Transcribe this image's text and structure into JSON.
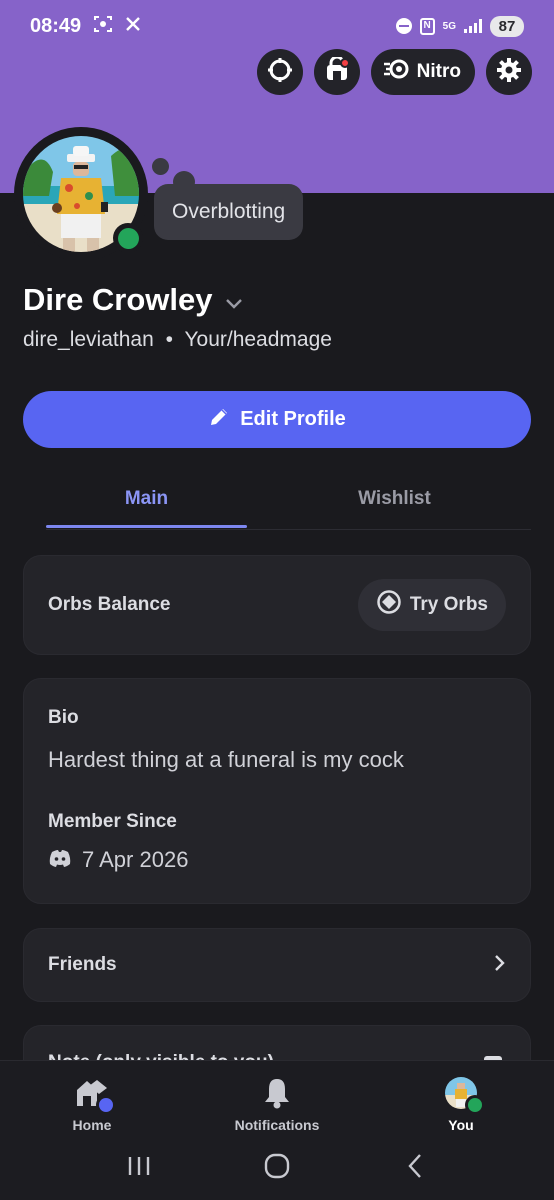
{
  "status_bar": {
    "time": "08:49",
    "network": "5G",
    "battery": "87",
    "icons": [
      "screenshot-icon",
      "x-icon",
      "dnd-icon",
      "nfc-icon",
      "signal-icon",
      "battery-icon"
    ]
  },
  "colors": {
    "banner": "#8663c9",
    "background": "#1a1a1e",
    "accent": "#5865f2",
    "online": "#23a55a",
    "card": "#242429",
    "tab_active": "#8b95f5"
  },
  "header_actions": {
    "nitro_label": "Nitro",
    "icons": [
      "orbs-icon",
      "shop-icon",
      "nitro-icon",
      "gear-icon"
    ]
  },
  "profile": {
    "custom_status": "Overblotting",
    "display_name": "Dire Crowley",
    "username": "dire_leviathan",
    "separator": "•",
    "pronouns": "Your/headmage"
  },
  "edit_profile_label": "Edit Profile",
  "tabs": [
    {
      "label": "Main",
      "active": true
    },
    {
      "label": "Wishlist",
      "active": false
    }
  ],
  "orbs": {
    "title": "Orbs Balance",
    "button": "Try Orbs"
  },
  "bio": {
    "label": "Bio",
    "text": "Hardest thing at a funeral is my cock",
    "member_since_label": "Member Since",
    "member_since_date": "7 Apr 2026"
  },
  "friends_label": "Friends",
  "note_label": "Note (only visible to you)",
  "bottom_nav": [
    {
      "label": "Home",
      "icon": "home-icon"
    },
    {
      "label": "Notifications",
      "icon": "bell-icon"
    },
    {
      "label": "You",
      "icon": "avatar"
    }
  ]
}
